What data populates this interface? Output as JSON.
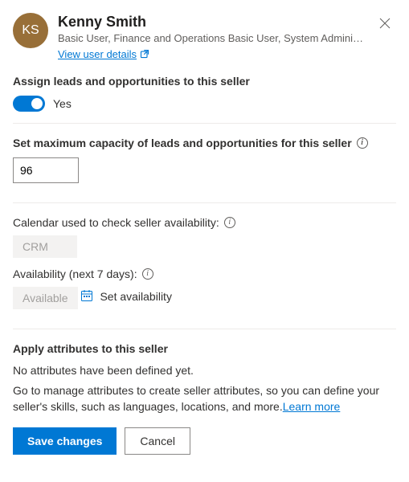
{
  "user": {
    "initials": "KS",
    "name": "Kenny Smith",
    "roles": "Basic User, Finance and Operations Basic User, System Administr…",
    "view_details_label": "View user details"
  },
  "sections": {
    "assign": {
      "label": "Assign leads and opportunities to this seller",
      "toggle_text": "Yes"
    },
    "capacity": {
      "label": "Set maximum capacity of leads and opportunities for this seller",
      "value": "96"
    },
    "calendar": {
      "label": "Calendar used to check seller availability:",
      "value": "CRM"
    },
    "availability": {
      "label": "Availability (next 7 days):",
      "value": "Available",
      "set_label": "Set availability"
    },
    "attributes": {
      "title": "Apply attributes to this seller",
      "empty_text": "No attributes have been defined yet.",
      "help_text": "Go to manage attributes to create seller attributes, so you can define your seller's skills, such as languages, locations, and more.",
      "learn_more": "Learn more"
    }
  },
  "footer": {
    "save": "Save changes",
    "cancel": "Cancel"
  }
}
